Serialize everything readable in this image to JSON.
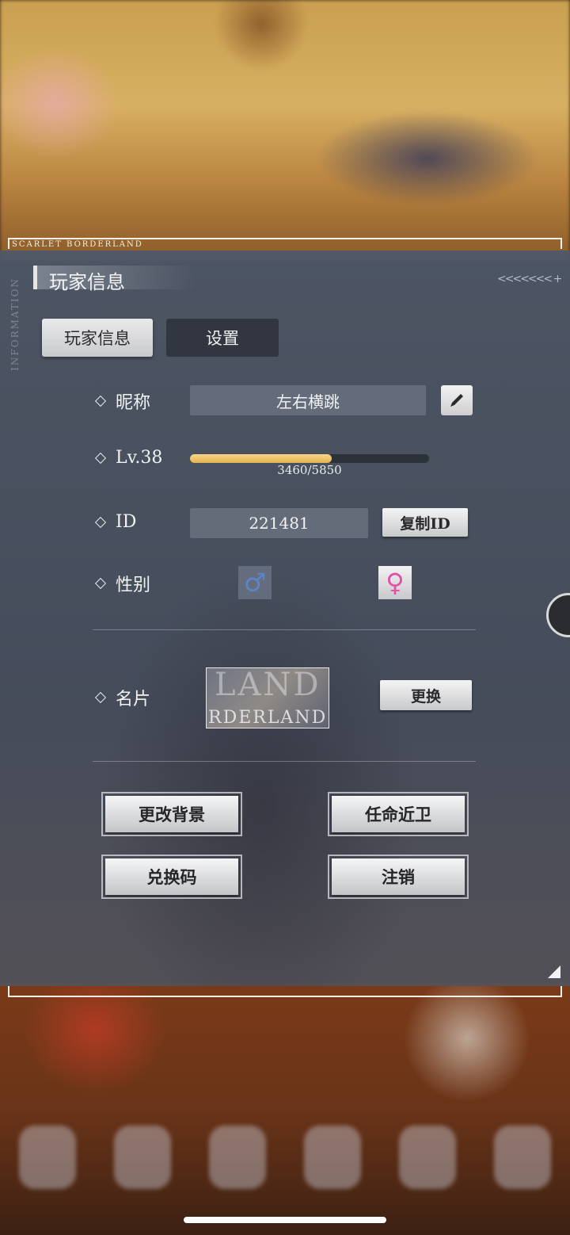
{
  "brand": "SCARLET BORDERLAND",
  "side_label": "INFORMATION",
  "panel_title": "玩家信息",
  "tabs": [
    {
      "label": "玩家信息",
      "active": true
    },
    {
      "label": "设置",
      "active": false
    }
  ],
  "nickname": {
    "label": "昵称",
    "value": "左右横跳"
  },
  "level": {
    "label": "Lv.38",
    "xp_text": "3460/5850",
    "xp_fraction": 0.5915
  },
  "id": {
    "label": "ID",
    "value": "221481",
    "copy_button": "复制ID"
  },
  "gender": {
    "label": "性别",
    "male_symbol": "♂",
    "female_symbol": "♀",
    "selected": "female"
  },
  "card": {
    "label": "名片",
    "preview_big": "LAND",
    "preview_small": "RDERLAND",
    "change_button": "更换"
  },
  "actions": {
    "change_background": "更改背景",
    "appoint_guard": "任命近卫",
    "redeem_code": "兑换码",
    "logout": "注销"
  },
  "colors": {
    "xp_fill": "#e3b450",
    "female_accent": "#e24fa6",
    "male_accent": "#5a86c8"
  }
}
